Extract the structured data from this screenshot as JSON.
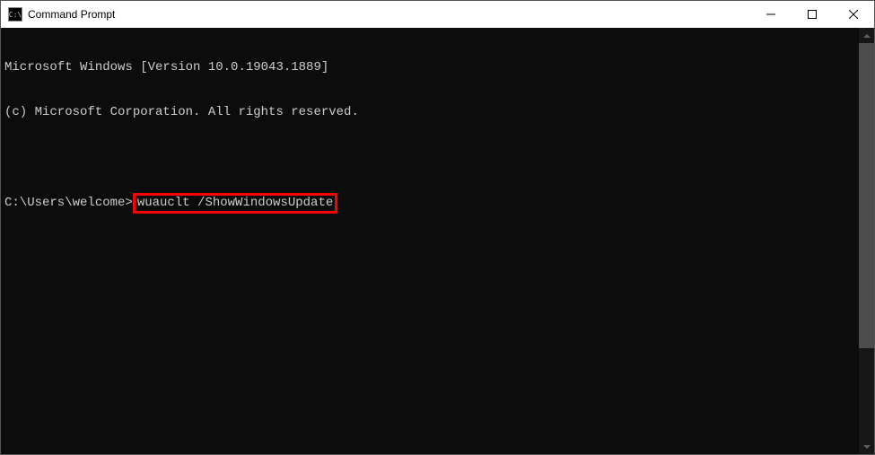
{
  "titlebar": {
    "icon_text": "C:\\",
    "title": "Command Prompt"
  },
  "console": {
    "line1": "Microsoft Windows [Version 10.0.19043.1889]",
    "line2": "(c) Microsoft Corporation. All rights reserved.",
    "prompt": "C:\\Users\\welcome>",
    "command": "wuauclt /ShowWindowsUpdate"
  }
}
